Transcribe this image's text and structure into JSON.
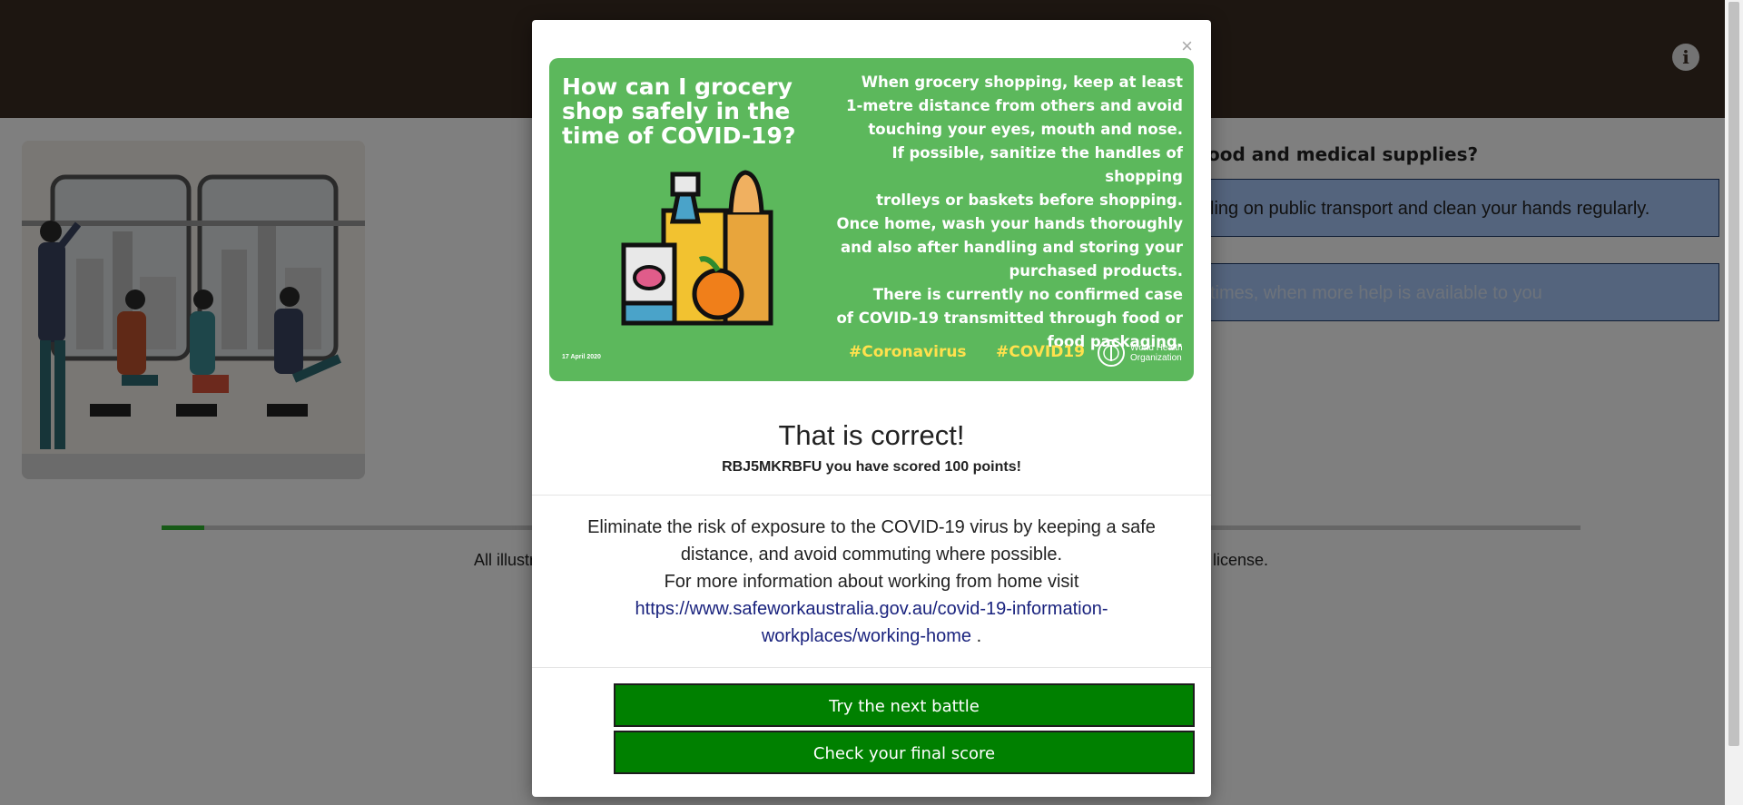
{
  "background": {
    "question_fragment": "ood and medical supplies?",
    "answer_1_fragment": "ling on public transport and clean your hands regularly.",
    "answer_2_fragment": "times, when more help is available to you",
    "footer_left": "All illustr",
    "footer_right": "license.",
    "progress_fraction": 0.03,
    "info_icon": "info-icon"
  },
  "poster": {
    "title": "How can I grocery shop safely in the time of COVID-19?",
    "body_lines": [
      "When grocery shopping, keep at least",
      "1-metre distance from others and avoid",
      "touching your eyes, mouth and nose.",
      "If possible, sanitize the handles of shopping",
      "trolleys or baskets before shopping.",
      "Once home, wash your hands thoroughly",
      "and also after handling and storing your",
      "purchased products.",
      "There is currently no confirmed case",
      "of COVID-19 transmitted through food or",
      "food packaging."
    ],
    "date": "17 April 2020",
    "hashtag_1": "#Coronavirus",
    "hashtag_2": "#COVID19",
    "org_line_1": "World Health",
    "org_line_2": "Organization",
    "bg_color": "#5cb85c",
    "hashtag_color": "#ffe14d"
  },
  "modal": {
    "close_label": "×",
    "heading": "That is correct!",
    "score_text": "RBJ5MKRBFU you have scored 100 points!",
    "body_line_1": "Eliminate the risk of exposure to the COVID-19 virus by keeping a safe distance, and avoid commuting where possible.",
    "body_line_2": "For more information about working from home visit",
    "link_text": "https://www.safeworkaustralia.gov.au/covid-19-information-workplaces/working-home",
    "link_suffix": " .",
    "button_next": "Try the next battle",
    "button_final": "Check your final score",
    "button_color": "#008000"
  }
}
